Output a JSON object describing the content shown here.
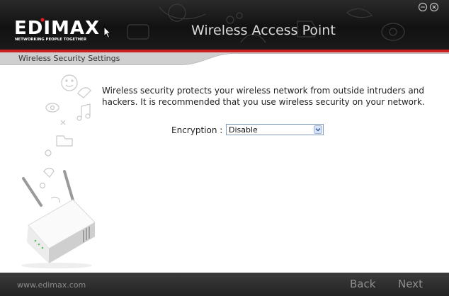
{
  "header": {
    "brand": "EDIMAX",
    "tagline": "NETWORKING PEOPLE TOGETHER",
    "app_title": "Wireless Access Point"
  },
  "section": {
    "title": "Wireless Security Settings"
  },
  "main": {
    "description": "Wireless security protects your wireless network from outside intruders and hackers. It is recommended that you use wireless security on your network.",
    "encryption_label": "Encryption :",
    "encryption_value": "Disable"
  },
  "footer": {
    "url": "www.edimax.com",
    "back_label": "Back",
    "next_label": "Next"
  },
  "icons": {
    "minimize": "minimize-icon",
    "close": "close-icon",
    "dropdown": "chevron-down-icon"
  },
  "colors": {
    "accent_red": "#cc1f24",
    "header_dark": "#1a1a1a"
  }
}
